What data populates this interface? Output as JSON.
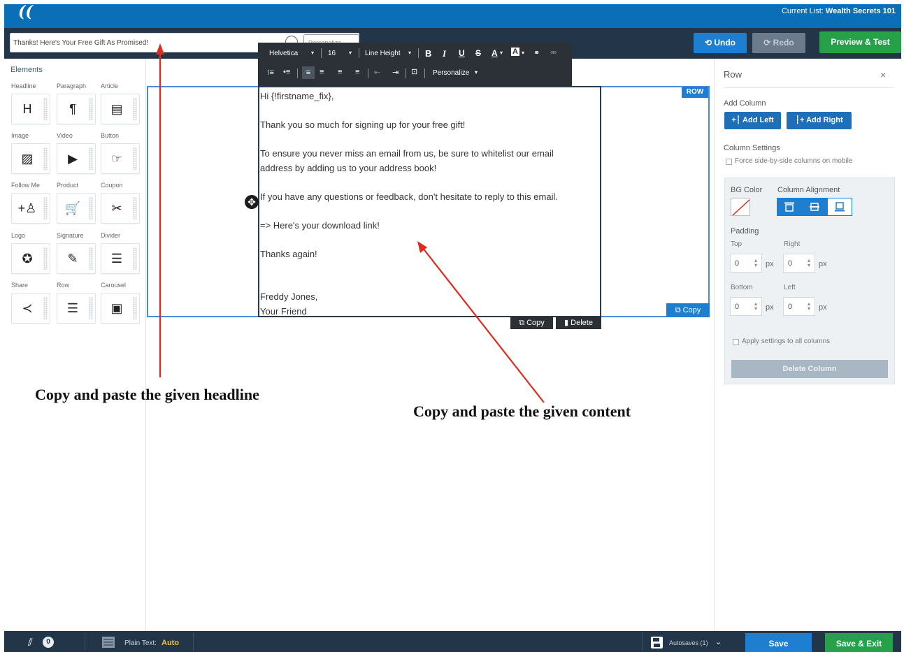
{
  "header": {
    "logo": "((",
    "current_list_label": "Current List:",
    "current_list_value": "Wealth Secrets 101"
  },
  "subject": {
    "value": "Thanks! Here's Your Free Gift As Promised!",
    "personalize": "Personalize"
  },
  "actions": {
    "undo": "⟲ Undo",
    "redo": "⟳ Redo",
    "preview": "Preview & Test"
  },
  "elements": {
    "title": "Elements",
    "items": [
      {
        "label": "Headline",
        "icon": "H"
      },
      {
        "label": "Paragraph",
        "icon": "¶"
      },
      {
        "label": "Article",
        "icon": "▤"
      },
      {
        "label": "Image",
        "icon": "▨"
      },
      {
        "label": "Video",
        "icon": "▶"
      },
      {
        "label": "Button",
        "icon": "☞"
      },
      {
        "label": "Follow Me",
        "icon": "+♙"
      },
      {
        "label": "Product",
        "icon": "🛒"
      },
      {
        "label": "Coupon",
        "icon": "✂"
      },
      {
        "label": "Logo",
        "icon": "✪"
      },
      {
        "label": "Signature",
        "icon": "✎"
      },
      {
        "label": "Divider",
        "icon": "☰"
      },
      {
        "label": "Share",
        "icon": "≺"
      },
      {
        "label": "Row",
        "icon": "☰"
      },
      {
        "label": "Carousel",
        "icon": "▣"
      }
    ]
  },
  "toolbar": {
    "font": "Helvetica",
    "size": "16",
    "line_height": "Line Height",
    "bold": "B",
    "italic": "I",
    "underline": "U",
    "strike": "S",
    "font_color": "A",
    "bg_color": "A",
    "personalize": "Personalize"
  },
  "email": {
    "lines": [
      "Hi {!firstname_fix},",
      "",
      "Thank you so much for signing up for your free gift!",
      "",
      "To ensure you never miss an email from us, be sure to whitelist our email",
      "address by adding us to your address book!",
      "",
      "If you have any questions or feedback, don't hesitate to reply to this email.",
      "",
      "=> Here's your download link!",
      "",
      "Thanks again!",
      "",
      "",
      "Freddy Jones,",
      "Your Friend"
    ]
  },
  "row": {
    "tag": "ROW",
    "copy": "Copy",
    "col_copy": "Copy",
    "col_delete": "Delete"
  },
  "annotations": {
    "headline": "Copy and paste the given headline",
    "content": "Copy and paste the given content",
    "arrow_color": "#e02a1e"
  },
  "panel": {
    "title": "Row",
    "close": "×",
    "add_column": "Add Column",
    "add_left": "Add Left",
    "add_right": "Add Right",
    "column_settings": "Column Settings",
    "force_side": "Force side-by-side columns on mobile",
    "bg_color": "BG Color",
    "column_alignment": "Column Alignment",
    "padding": "Padding",
    "top": "Top",
    "right": "Right",
    "bottom": "Bottom",
    "left": "Left",
    "top_value": "0",
    "right_value": "0",
    "bottom_value": "0",
    "left_value": "0",
    "unit": "px",
    "apply_all": "Apply settings to all columns",
    "delete_column": "Delete Column"
  },
  "footer": {
    "attach_count": "0",
    "plain_text_label": "Plain Text:",
    "plain_text_value": "Auto",
    "autosaves": "Autosaves (1)",
    "save": "Save",
    "save_exit": "Save & Exit"
  },
  "colors": {
    "brand_blue": "#0b6fb8",
    "dark_nav": "#233549",
    "green": "#27a04a",
    "accent": "#1e7fd0"
  }
}
